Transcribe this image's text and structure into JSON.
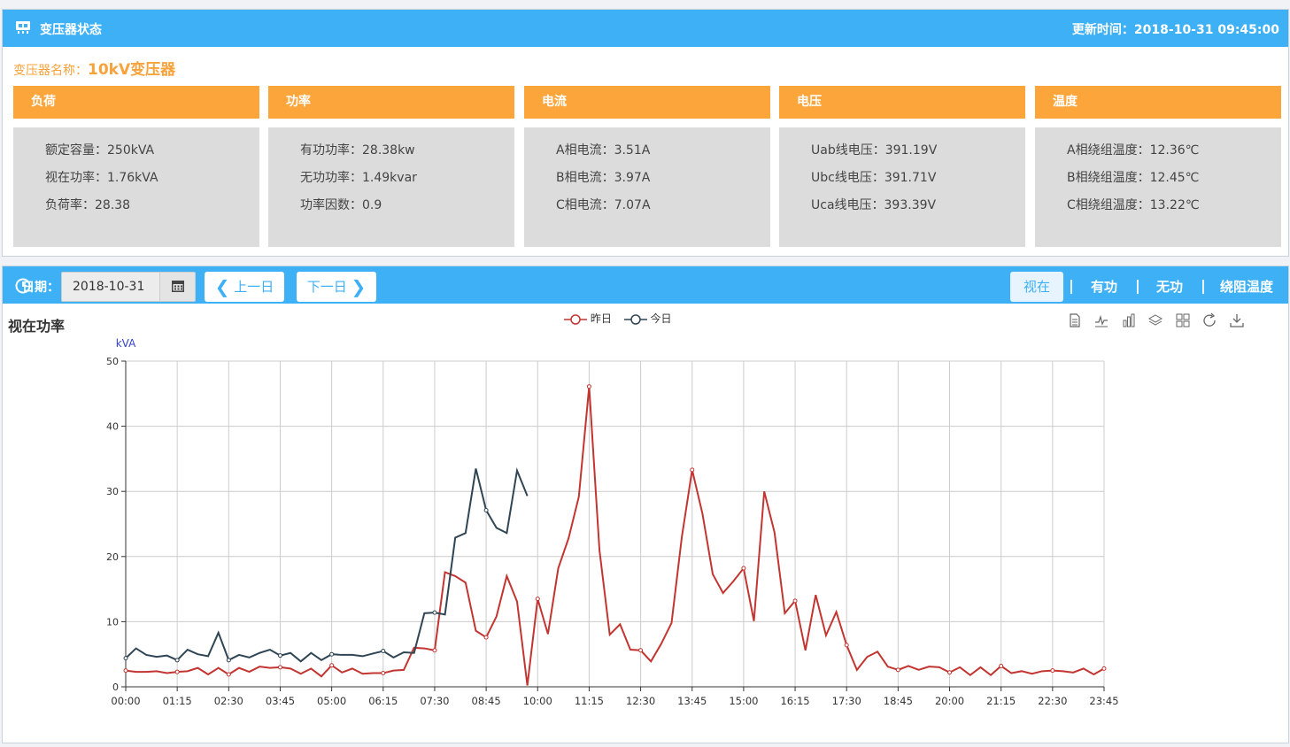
{
  "status": {
    "title": "变压器状态",
    "update_label": "更新时间：",
    "update_time": "2018-10-31 09:45:00",
    "name_label": "变压器名称：",
    "name_value": "10kV变压器",
    "cards": [
      {
        "title": "负荷",
        "rows": [
          "额定容量：250kVA",
          "视在功率：1.76kVA",
          "负荷率：28.38"
        ]
      },
      {
        "title": "功率",
        "rows": [
          "有功功率：28.38kw",
          "无功功率：1.49kvar",
          "功率因数：0.9"
        ]
      },
      {
        "title": "电流",
        "rows": [
          "A相电流：3.51A",
          "B相电流：3.97A",
          "C相电流：7.07A"
        ]
      },
      {
        "title": "电压",
        "rows": [
          "Uab线电压：391.19V",
          "Ubc线电压：391.71V",
          "Uca线电压：393.39V"
        ]
      },
      {
        "title": "温度",
        "rows": [
          "A相绕组温度：12.36℃",
          "B相绕组温度：12.45℃",
          "C相绕组温度：13.22℃"
        ]
      }
    ],
    "colors": {
      "header": "#3eb0f6",
      "card_head": "#fca53a",
      "card_body": "#dcdcdc",
      "name": "#f7a23a"
    }
  },
  "toolbar": {
    "date_label": "日期：",
    "date_value": "2018-10-31",
    "prev_label": "上一日",
    "next_label": "下一日",
    "tabs": [
      "视在",
      "有功",
      "无功",
      "绕阻温度"
    ],
    "active_tab": "视在",
    "separator": "|",
    "icons": [
      "calendar-icon",
      "chevron-left-icon",
      "chevron-right-icon",
      "clock-icon"
    ]
  },
  "chart_data": {
    "type": "line",
    "title": "视在功率",
    "ylabel": "kVA",
    "ylim": [
      0,
      50
    ],
    "yticks": [
      0,
      10,
      20,
      30,
      40,
      50
    ],
    "xticks": [
      "00:00",
      "01:15",
      "02:30",
      "03:45",
      "05:00",
      "06:15",
      "07:30",
      "08:45",
      "10:00",
      "11:15",
      "12:30",
      "13:45",
      "15:00",
      "16:15",
      "17:30",
      "18:45",
      "20:00",
      "21:15",
      "22:30",
      "23:45"
    ],
    "x_interval_minutes": 15,
    "grid": true,
    "legend_position": "top-center",
    "toolbox_icons": [
      "data-view-icon",
      "line-icon",
      "bar-icon",
      "stack-icon",
      "tiled-icon",
      "restore-icon",
      "save-image-icon"
    ],
    "series": [
      {
        "name": "昨日",
        "color": "#c23531",
        "values": [
          2.5,
          2.3,
          2.3,
          2.4,
          2.1,
          2.3,
          2.4,
          2.9,
          1.9,
          2.9,
          1.9,
          2.9,
          2.3,
          3.1,
          2.9,
          3.0,
          2.8,
          2.0,
          2.8,
          1.6,
          3.3,
          2.2,
          2.8,
          2.0,
          2.1,
          2.1,
          2.5,
          2.6,
          6.0,
          5.9,
          5.6,
          17.6,
          17.0,
          16.0,
          8.6,
          7.6,
          10.8,
          17.0,
          13.1,
          0.2,
          13.5,
          8.1,
          18.2,
          22.8,
          29.2,
          46.1,
          21.0,
          8.0,
          9.6,
          5.7,
          5.6,
          3.9,
          6.6,
          9.8,
          23.0,
          33.3,
          26.6,
          17.3,
          14.4,
          16.2,
          18.2,
          10.1,
          30.0,
          23.7,
          11.3,
          13.2,
          5.6,
          14.1,
          7.9,
          11.5,
          6.4,
          2.6,
          4.6,
          5.4,
          3.1,
          2.6,
          3.2,
          2.6,
          3.1,
          3.0,
          2.2,
          3.0,
          1.8,
          3.0,
          1.8,
          3.2,
          2.1,
          2.4,
          2.0,
          2.4,
          2.5,
          2.4,
          2.2,
          2.8,
          1.9,
          2.8
        ]
      },
      {
        "name": "今日",
        "color": "#2f4554",
        "values": [
          4.4,
          5.9,
          4.9,
          4.6,
          4.8,
          4.1,
          5.7,
          5.0,
          4.7,
          8.3,
          4.1,
          4.9,
          4.5,
          5.2,
          5.7,
          4.8,
          5.2,
          3.9,
          5.2,
          4.1,
          5.0,
          4.9,
          4.9,
          4.7,
          5.1,
          5.5,
          4.5,
          5.3,
          5.2,
          11.3,
          11.4,
          11.1,
          22.9,
          23.6,
          33.5,
          27.1,
          24.4,
          23.6,
          33.2,
          29.3
        ]
      }
    ]
  }
}
